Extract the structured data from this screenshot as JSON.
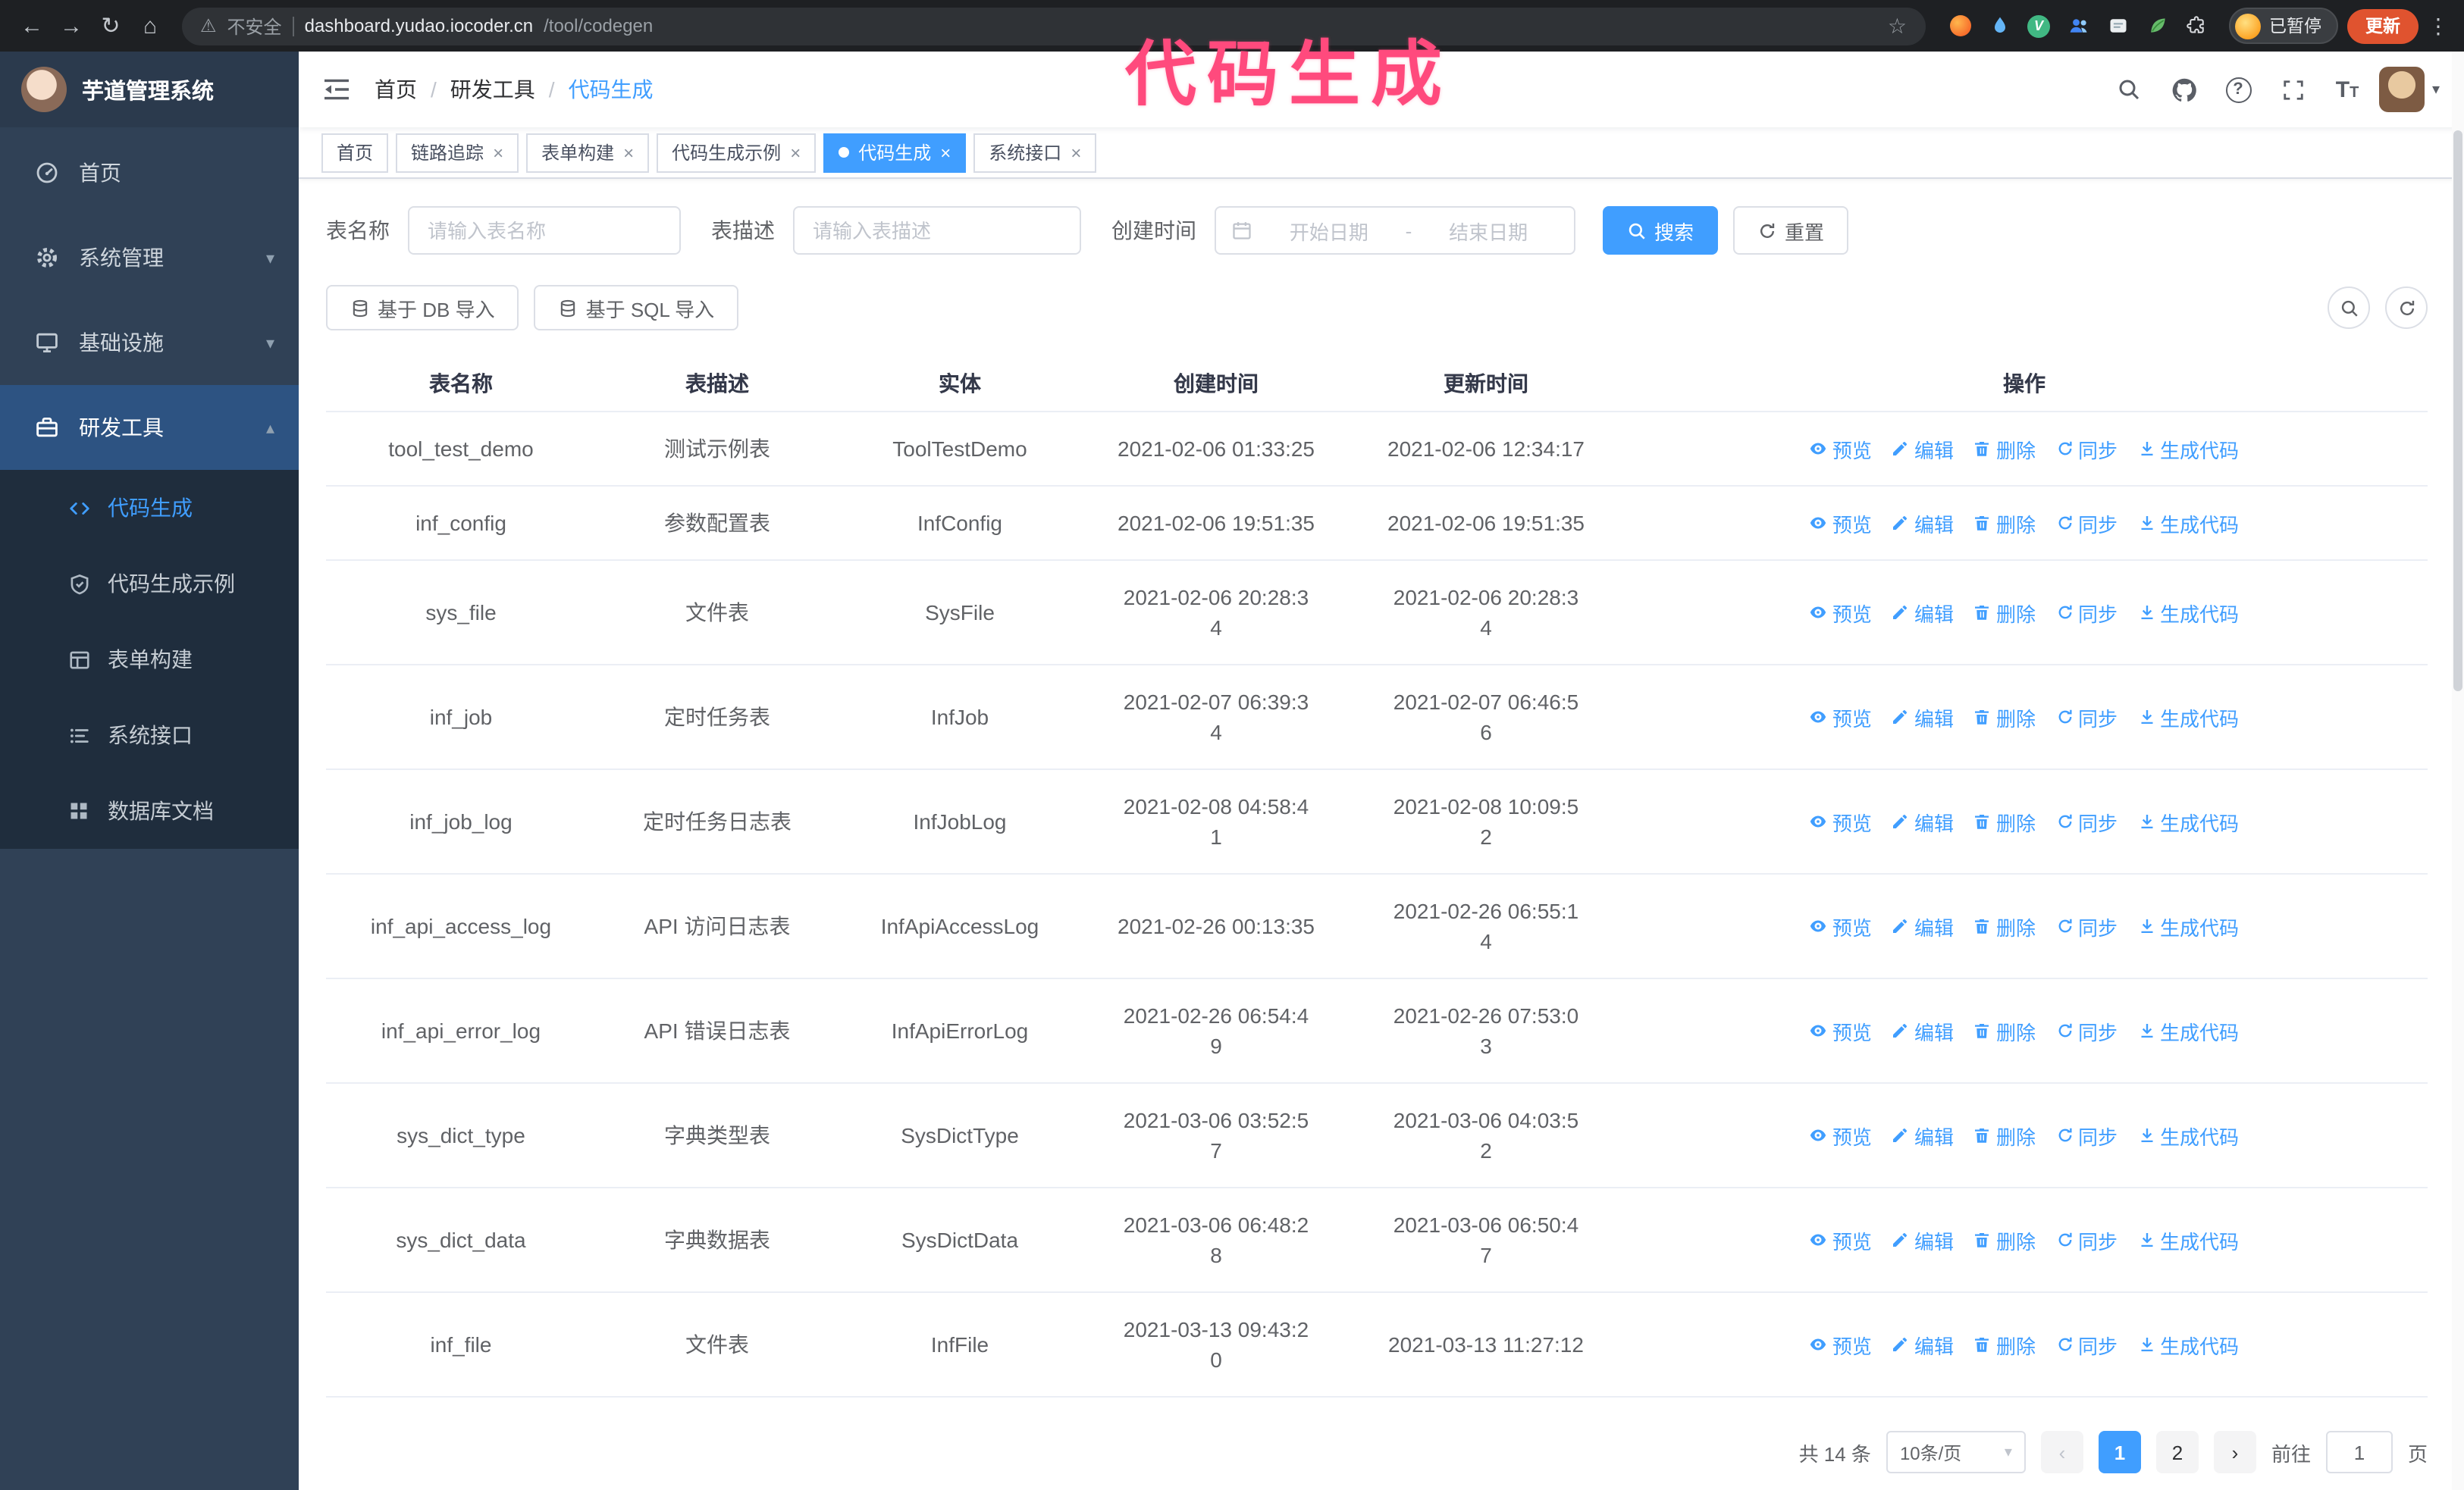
{
  "annotation": {
    "text": "代码生成",
    "color": "#ff4a7d"
  },
  "colors": {
    "primary": "#409eff",
    "sidebar_bg": "#304156",
    "submenu_bg": "#1f2d3d",
    "update_button": "#e0532f"
  },
  "icons": {
    "back": "←",
    "forward": "→",
    "reload": "↻",
    "home": "⌂",
    "warning": "⚠",
    "star": "☆",
    "kebab": "⋮",
    "close": "×",
    "caret_down": "▾",
    "caret_up": "▴",
    "prev": "‹",
    "next": "›",
    "question": "?"
  },
  "browser": {
    "security_label": "不安全",
    "url_host": "dashboard.yudao.iocoder.cn",
    "url_path": "/tool/codegen",
    "profile_label": "已暂停",
    "update_label": "更新"
  },
  "sidebar": {
    "logo_title": "芋道管理系统",
    "items": [
      {
        "label": "首页"
      },
      {
        "label": "系统管理"
      },
      {
        "label": "基础设施"
      },
      {
        "label": "研发工具",
        "expanded": true,
        "children": [
          {
            "label": "代码生成",
            "active": true
          },
          {
            "label": "代码生成示例"
          },
          {
            "label": "表单构建"
          },
          {
            "label": "系统接口"
          },
          {
            "label": "数据库文档"
          }
        ]
      }
    ]
  },
  "header": {
    "breadcrumb": [
      "首页",
      "研发工具",
      "代码生成"
    ]
  },
  "tabs": [
    {
      "label": "首页",
      "closable": false
    },
    {
      "label": "链路追踪",
      "closable": true
    },
    {
      "label": "表单构建",
      "closable": true
    },
    {
      "label": "代码生成示例",
      "closable": true
    },
    {
      "label": "代码生成",
      "closable": true,
      "active": true
    },
    {
      "label": "系统接口",
      "closable": true
    }
  ],
  "filters": {
    "table_name_label": "表名称",
    "table_name_placeholder": "请输入表名称",
    "table_desc_label": "表描述",
    "table_desc_placeholder": "请输入表描述",
    "create_time_label": "创建时间",
    "start_placeholder": "开始日期",
    "range_separator": "-",
    "end_placeholder": "结束日期",
    "search_label": "搜索",
    "reset_label": "重置",
    "import_db_label": "基于 DB 导入",
    "import_sql_label": "基于 SQL 导入"
  },
  "table": {
    "columns": [
      "表名称",
      "表描述",
      "实体",
      "创建时间",
      "更新时间",
      "操作"
    ],
    "actions": [
      "预览",
      "编辑",
      "删除",
      "同步",
      "生成代码"
    ],
    "rows": [
      {
        "name": "tool_test_demo",
        "desc": "测试示例表",
        "entity": "ToolTestDemo",
        "created": "2021-02-06 01:33:25",
        "updated": "2021-02-06 12:34:17"
      },
      {
        "name": "inf_config",
        "desc": "参数配置表",
        "entity": "InfConfig",
        "created": "2021-02-06 19:51:35",
        "updated": "2021-02-06 19:51:35"
      },
      {
        "name": "sys_file",
        "desc": "文件表",
        "entity": "SysFile",
        "created": "2021-02-06 20:28:3\n4",
        "updated": "2021-02-06 20:28:3\n4"
      },
      {
        "name": "inf_job",
        "desc": "定时任务表",
        "entity": "InfJob",
        "created": "2021-02-07 06:39:3\n4",
        "updated": "2021-02-07 06:46:5\n6"
      },
      {
        "name": "inf_job_log",
        "desc": "定时任务日志表",
        "entity": "InfJobLog",
        "created": "2021-02-08 04:58:4\n1",
        "updated": "2021-02-08 10:09:5\n2"
      },
      {
        "name": "inf_api_access_log",
        "desc": "API 访问日志表",
        "entity": "InfApiAccessLog",
        "created": "2021-02-26 00:13:35",
        "updated": "2021-02-26 06:55:1\n4"
      },
      {
        "name": "inf_api_error_log",
        "desc": "API 错误日志表",
        "entity": "InfApiErrorLog",
        "created": "2021-02-26 06:54:4\n9",
        "updated": "2021-02-26 07:53:0\n3"
      },
      {
        "name": "sys_dict_type",
        "desc": "字典类型表",
        "entity": "SysDictType",
        "created": "2021-03-06 03:52:5\n7",
        "updated": "2021-03-06 04:03:5\n2"
      },
      {
        "name": "sys_dict_data",
        "desc": "字典数据表",
        "entity": "SysDictData",
        "created": "2021-03-06 06:48:2\n8",
        "updated": "2021-03-06 06:50:4\n7"
      },
      {
        "name": "inf_file",
        "desc": "文件表",
        "entity": "InfFile",
        "created": "2021-03-13 09:43:2\n0",
        "updated": "2021-03-13 11:27:12"
      }
    ]
  },
  "pagination": {
    "total_text": "共 14 条",
    "page_size": "10条/页",
    "pages": [
      "1",
      "2"
    ],
    "active_page": "1",
    "goto_label": "前往",
    "goto_value": "1",
    "goto_suffix": "页"
  }
}
